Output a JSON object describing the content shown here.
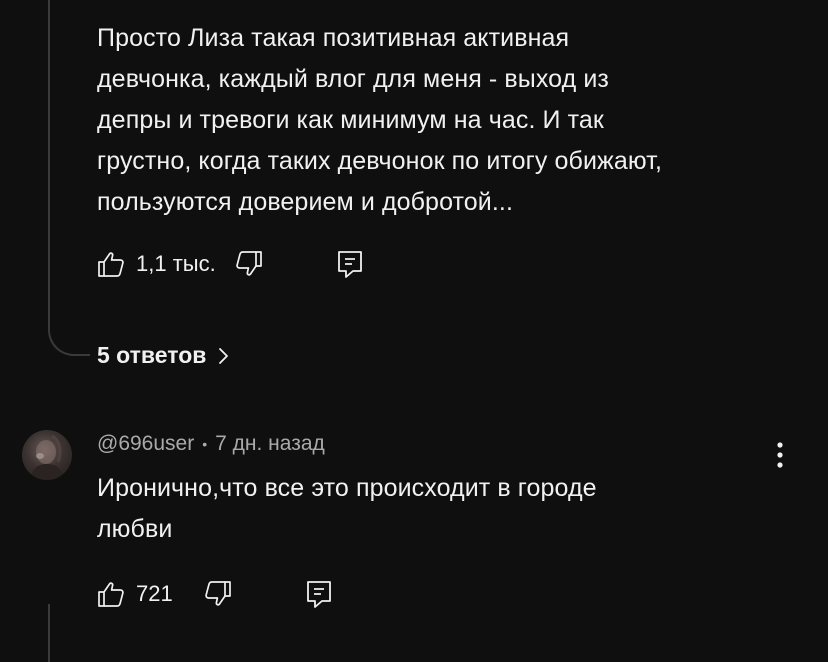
{
  "comment_1": {
    "text": "Просто Лиза такая позитивная активная\nдевчонка, каждый влог  для меня - выход из\nдепры и тревоги как минимум на час. И так\nгрустно, когда таких девчонок по итогу обижают,\nпользуются доверием и добротой...",
    "like_count": "1,1 тыс.",
    "replies_label": "5 ответов"
  },
  "comment_2": {
    "author": "@696user",
    "separator": "•",
    "time": "7 дн. назад",
    "text": "Иронично,что все это происходит в городе\nлюбви",
    "like_count": "721"
  },
  "icons": {
    "like": "thumbs-up-icon",
    "dislike": "thumbs-down-icon",
    "reply": "reply-comment-icon",
    "replies_chevron": "chevron-right-icon",
    "more": "more-vertical-icon"
  },
  "colors": {
    "background": "#0f0f0f",
    "text": "#f1f1f1",
    "secondary_text": "#aaaaaa",
    "thread_line": "#3a3a3a"
  }
}
